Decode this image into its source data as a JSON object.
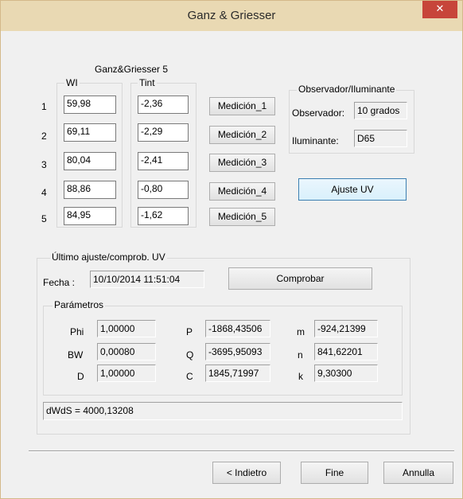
{
  "window": {
    "title": "Ganz & Griesser",
    "close_glyph": "✕"
  },
  "meas_group_title": "Ganz&Griesser 5",
  "wi_label": "WI",
  "tint_label": "Tint",
  "rows": [
    {
      "num": "1",
      "wi": "59,98",
      "tint": "-2,36",
      "button": "Medición_1"
    },
    {
      "num": "2",
      "wi": "69,11",
      "tint": "-2,29",
      "button": "Medición_2"
    },
    {
      "num": "3",
      "wi": "80,04",
      "tint": "-2,41",
      "button": "Medición_3"
    },
    {
      "num": "4",
      "wi": "88,86",
      "tint": "-0,80",
      "button": "Medición_4"
    },
    {
      "num": "5",
      "wi": "84,95",
      "tint": "-1,62",
      "button": "Medición_5"
    }
  ],
  "observer": {
    "title": "Observador/Iluminante",
    "observer_label": "Observador:",
    "observer_value": "10 grados",
    "illuminant_label": "Iluminante:",
    "illuminant_value": "D65"
  },
  "ajuste_uv_button": "Ajuste UV",
  "last_adjust": {
    "title": "Último ajuste/comprob. UV",
    "fecha_label": "Fecha :",
    "fecha_value": "10/10/2014 11:51:04",
    "comprobar_button": "Comprobar",
    "params_title": "Parámetros",
    "phi_label": "Phi",
    "phi_value": "1,00000",
    "bw_label": "BW",
    "bw_value": "0,00080",
    "d_label": "D",
    "d_value": "1,00000",
    "p_label": "P",
    "p_value": "-1868,43506",
    "q_label": "Q",
    "q_value": "-3695,95093",
    "c_label": "C",
    "c_value": "1845,71997",
    "m_label": "m",
    "m_value": "-924,21399",
    "n_label": "n",
    "n_value": "841,62201",
    "k_label": "k",
    "k_value": "9,30300",
    "dwds_value": "dWdS = 4000,13208"
  },
  "footer": {
    "back_button": "< Indietro",
    "finish_button": "Fine",
    "cancel_button": "Annulla"
  }
}
